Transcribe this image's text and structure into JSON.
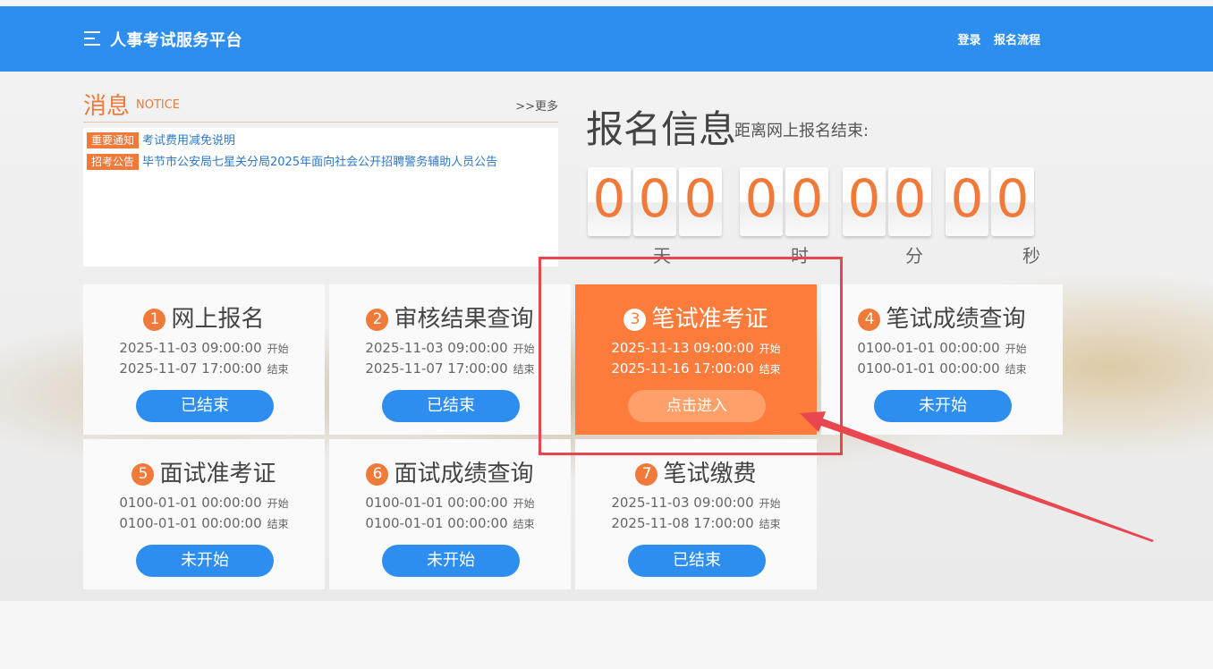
{
  "header": {
    "site_title": "人事考试服务平台",
    "login_link": "登录",
    "process_link": "报名流程"
  },
  "notice": {
    "title": "消息",
    "subtitle": "NOTICE",
    "more": ">>更多",
    "items": [
      {
        "tag": "重要通知",
        "text": "考试费用减免说明"
      },
      {
        "tag": "招考公告",
        "text": "毕节市公安局七星关分局2025年面向社会公开招聘警务辅助人员公告"
      }
    ]
  },
  "registration": {
    "title": "报名信息",
    "subtitle": "距离网上报名结束:",
    "days_digits": [
      "0",
      "0",
      "0"
    ],
    "hours_digits": [
      "0",
      "0"
    ],
    "minutes_digits": [
      "0",
      "0"
    ],
    "seconds_digits": [
      "0",
      "0"
    ],
    "units": {
      "days": "天",
      "hours": "时",
      "minutes": "分",
      "seconds": "秒"
    }
  },
  "cards": [
    {
      "num": "1",
      "title": "网上报名",
      "start": "2025-11-03 09:00:00",
      "start_label": "开始",
      "end": "2025-11-07 17:00:00",
      "end_label": "结束",
      "button": "已结束"
    },
    {
      "num": "2",
      "title": "审核结果查询",
      "start": "2025-11-03 09:00:00",
      "start_label": "开始",
      "end": "2025-11-07 17:00:00",
      "end_label": "结束",
      "button": "已结束"
    },
    {
      "num": "3",
      "title": "笔试准考证",
      "start": "2025-11-13 09:00:00",
      "start_label": "开始",
      "end": "2025-11-16 17:00:00",
      "end_label": "结束",
      "button": "点击进入"
    },
    {
      "num": "4",
      "title": "笔试成绩查询",
      "start": "0100-01-01 00:00:00",
      "start_label": "开始",
      "end": "0100-01-01 00:00:00",
      "end_label": "结束",
      "button": "未开始"
    },
    {
      "num": "5",
      "title": "面试准考证",
      "start": "0100-01-01 00:00:00",
      "start_label": "开始",
      "end": "0100-01-01 00:00:00",
      "end_label": "结束",
      "button": "未开始"
    },
    {
      "num": "6",
      "title": "面试成绩查询",
      "start": "0100-01-01 00:00:00",
      "start_label": "开始",
      "end": "0100-01-01 00:00:00",
      "end_label": "结束",
      "button": "未开始"
    },
    {
      "num": "7",
      "title": "笔试缴费",
      "start": "2025-11-03 09:00:00",
      "start_label": "开始",
      "end": "2025-11-08 17:00:00",
      "end_label": "结束",
      "button": "已结束"
    }
  ],
  "colors": {
    "header_blue": "#2e8ef0",
    "accent_orange": "#f07a3a",
    "active_card": "#fd7c3b",
    "annotation_red": "#e8474f"
  },
  "icons": {
    "menu": "menu-lines-icon"
  }
}
